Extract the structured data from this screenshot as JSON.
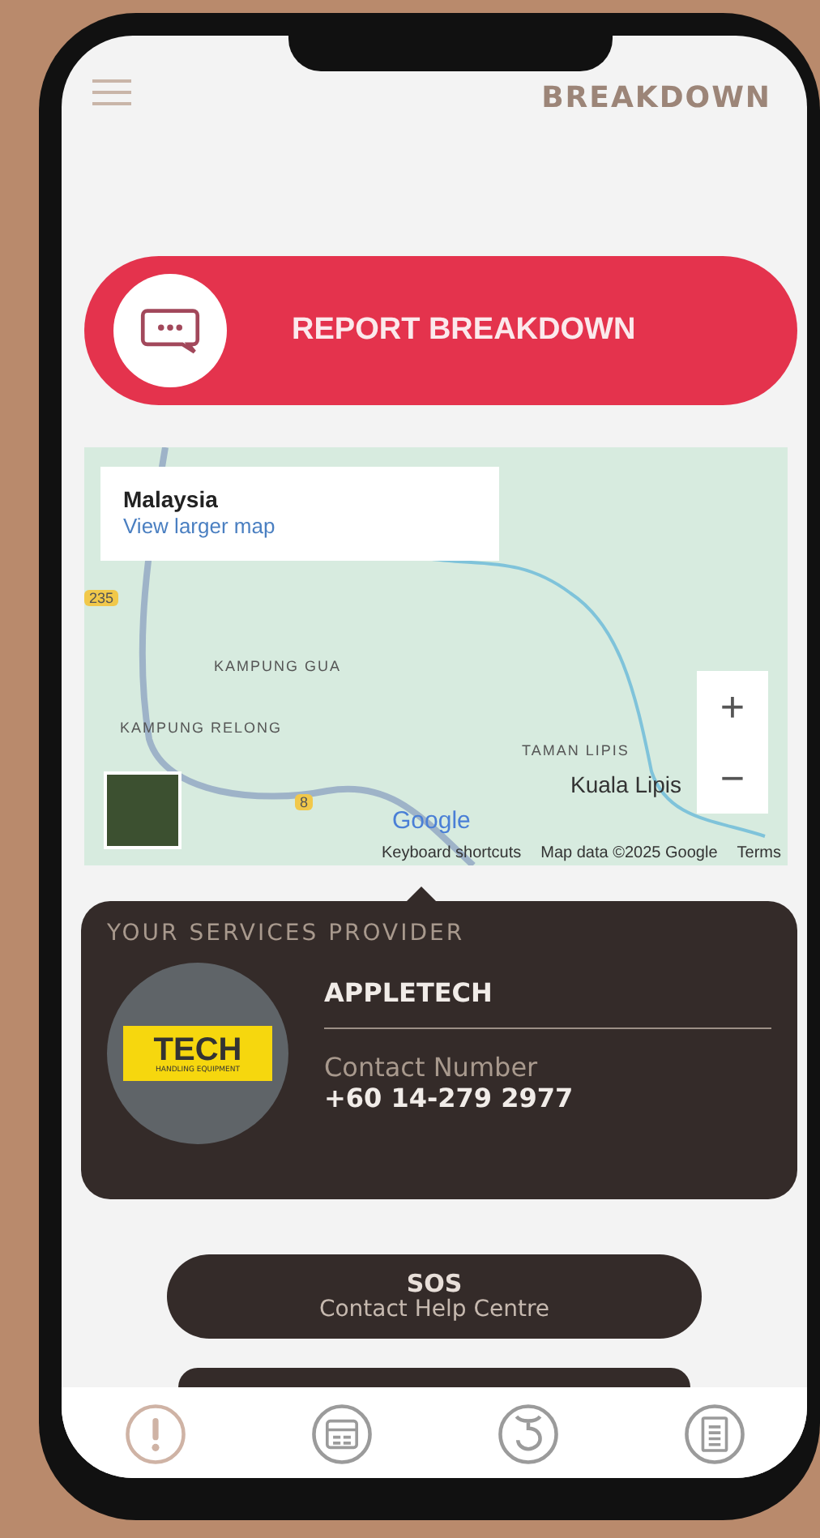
{
  "header": {
    "title": "BREAKDOWN"
  },
  "report_button": {
    "label": "REPORT BREAKDOWN"
  },
  "map": {
    "place_card": {
      "title": "Malaysia",
      "link": "View larger map"
    },
    "labels": [
      {
        "kind": "shield",
        "text": "235"
      },
      {
        "kind": "place",
        "text": "KAMPUNG GUA"
      },
      {
        "kind": "place",
        "text": "KAMPUNG RELONG"
      },
      {
        "kind": "shield",
        "text": "8"
      },
      {
        "kind": "place",
        "text": "TAMAN LIPIS"
      },
      {
        "kind": "town",
        "text": "Kuala Lipis"
      }
    ],
    "logo": "Google",
    "zoom_in": "+",
    "zoom_out": "−",
    "footer": [
      "Keyboard shortcuts",
      "Map data ©2025 Google",
      "Terms"
    ]
  },
  "provider": {
    "heading": "YOUR SERVICES PROVIDER",
    "logo_text": "TECH",
    "logo_subtext": "HANDLING EQUIPMENT",
    "name": "APPLETECH",
    "contact_label": "Contact Number",
    "contact_number": "+60 14-279 2977"
  },
  "sos_button": {
    "title": "SOS",
    "subtitle": "Contact Help Centre"
  },
  "nav": [
    {
      "kind": "alert",
      "selected": true
    },
    {
      "kind": "calendar",
      "selected": false
    },
    {
      "kind": "hook",
      "selected": false
    },
    {
      "kind": "document",
      "selected": false
    }
  ]
}
